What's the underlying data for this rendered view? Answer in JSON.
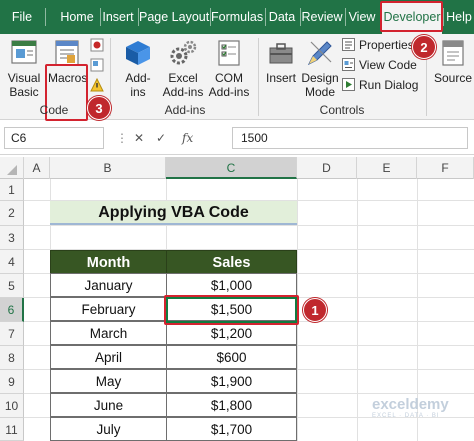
{
  "tabs": [
    {
      "label": "File",
      "active": false
    },
    {
      "label": "Home",
      "active": false
    },
    {
      "label": "Insert",
      "active": false
    },
    {
      "label": "Page Layout",
      "active": false
    },
    {
      "label": "Formulas",
      "active": false
    },
    {
      "label": "Data",
      "active": false
    },
    {
      "label": "Review",
      "active": false
    },
    {
      "label": "View",
      "active": false
    },
    {
      "label": "Developer",
      "active": true
    },
    {
      "label": "Help",
      "active": false
    }
  ],
  "ribbon": {
    "code_group": {
      "label": "Code",
      "visual_basic": {
        "line1": "Visual",
        "line2": "Basic"
      },
      "macros": {
        "label": "Macros"
      }
    },
    "addins_group": {
      "label": "Add-ins",
      "addins": {
        "line1": "Add-",
        "line2": "ins"
      },
      "excel_addins": {
        "line1": "Excel",
        "line2": "Add-ins"
      },
      "com_addins": {
        "line1": "COM",
        "line2": "Add-ins"
      }
    },
    "controls_group": {
      "label": "Controls",
      "insert": {
        "label": "Insert"
      },
      "design_mode": {
        "line1": "Design",
        "line2": "Mode"
      },
      "properties": "Properties",
      "view_code": "View Code",
      "run_dialog": "Run Dialog"
    },
    "source": {
      "label": "Source"
    }
  },
  "callouts": [
    "1",
    "2",
    "3"
  ],
  "formula_bar": {
    "name_box": "C6",
    "fx": "fx",
    "value": "1500"
  },
  "columns": [
    "A",
    "B",
    "C",
    "D",
    "E",
    "F"
  ],
  "rows": [
    "1",
    "2",
    "3",
    "4",
    "5",
    "6",
    "7",
    "8",
    "9",
    "10",
    "11"
  ],
  "sheet": {
    "title": "Applying VBA Code",
    "headers": [
      "Month",
      "Sales"
    ],
    "data": [
      [
        "January",
        "$1,000"
      ],
      [
        "February",
        "$1,500"
      ],
      [
        "March",
        "$1,200"
      ],
      [
        "April",
        "$600"
      ],
      [
        "May",
        "$1,900"
      ],
      [
        "June",
        "$1,800"
      ],
      [
        "July",
        "$1,700"
      ]
    ]
  },
  "watermark": {
    "brand": "exceldemy",
    "tagline": "EXCEL · DATA · BI"
  },
  "colors": {
    "excel_green": "#217346",
    "header_fill": "#375623",
    "title_fill": "#e2efda",
    "callout_red": "#c0282d"
  }
}
